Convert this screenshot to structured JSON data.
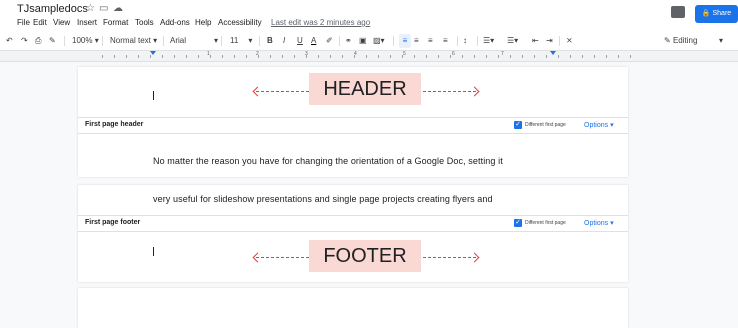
{
  "app": {
    "doc_title": "TJsampledocs",
    "menu": [
      "File",
      "Edit",
      "View",
      "Insert",
      "Format",
      "Tools",
      "Add-ons",
      "Help",
      "Accessibility"
    ],
    "last_edit": "Last edit was 2 minutes ago",
    "share_label": "Share"
  },
  "toolbar": {
    "zoom": "100%",
    "style": "Normal text",
    "font": "Arial",
    "size": "11",
    "bold": "B",
    "italic": "I",
    "underline": "U",
    "text_color": "A",
    "mode": "Editing"
  },
  "ruler": {
    "numbers": [
      "1",
      "2",
      "3",
      "4",
      "5",
      "6",
      "7"
    ]
  },
  "header": {
    "bar_label": "First page header",
    "checkbox_label": "Different first page",
    "options_label": "Options ▾",
    "annotation": "HEADER"
  },
  "body": {
    "line1": "No matter the reason you have for changing the orientation of a Google Doc, setting it",
    "line2": "very useful for slideshow presentations and single page projects creating flyers and"
  },
  "footer": {
    "bar_label": "First page footer",
    "checkbox_label": "Different first page",
    "options_label": "Options ▾",
    "annotation": "FOOTER"
  },
  "colors": {
    "accent": "#1a73e8",
    "annotation_bg": "#fad8d4",
    "arrow": "#e04040"
  }
}
